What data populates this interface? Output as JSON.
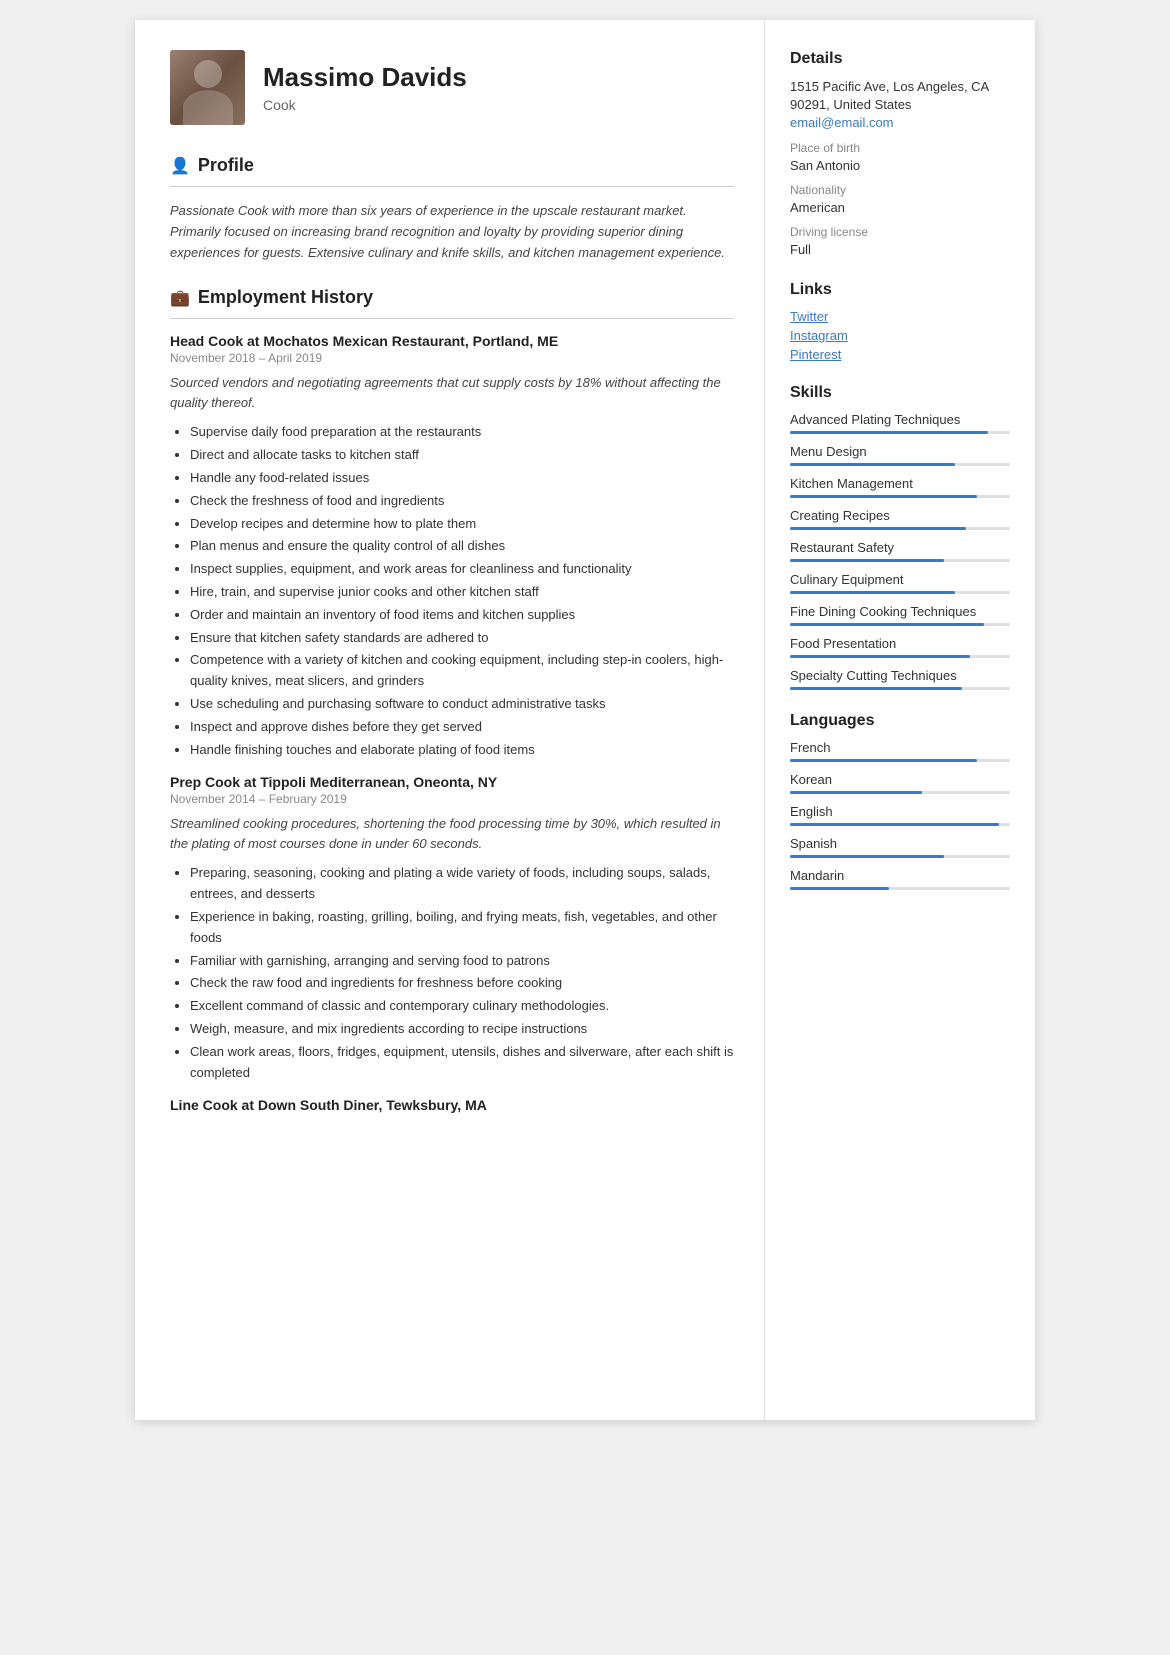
{
  "header": {
    "name": "Massimo Davids",
    "subtitle": "Cook",
    "avatar_alt": "Chef photo"
  },
  "profile": {
    "section_title": "Profile",
    "text": "Passionate Cook with more than six years of experience in the upscale restaurant market. Primarily focused on increasing brand recognition and loyalty by providing superior dining experiences for guests. Extensive culinary and knife skills, and kitchen management experience."
  },
  "employment": {
    "section_title": "Employment History",
    "jobs": [
      {
        "title": "Head Cook at Mochatos Mexican Restaurant, Portland, ME",
        "dates": "November 2018  –  April 2019",
        "summary": "Sourced vendors and negotiating agreements that cut supply costs by 18% without affecting the quality thereof.",
        "bullets": [
          "Supervise daily food preparation at the restaurants",
          "Direct and allocate tasks to kitchen staff",
          "Handle any food-related issues",
          "Check the freshness of food and ingredients",
          "Develop recipes and determine how to plate them",
          "Plan menus and ensure the quality control of all dishes",
          "Inspect supplies, equipment, and work areas for cleanliness and functionality",
          "Hire, train, and supervise junior cooks and other kitchen staff",
          "Order and maintain an inventory of food items and kitchen supplies",
          "Ensure that kitchen safety standards are adhered to",
          "Competence with a variety of kitchen and cooking equipment, including step-in coolers, high-quality knives, meat slicers, and grinders",
          "Use scheduling and purchasing software to conduct administrative tasks",
          "Inspect and approve dishes before they get served",
          "Handle finishing touches and elaborate plating of food items"
        ]
      },
      {
        "title": "Prep Cook at Tippoli Mediterranean, Oneonta, NY",
        "dates": "November 2014  –  February 2019",
        "summary": "Streamlined cooking procedures, shortening the food processing time by 30%, which resulted in the plating of most courses done in under 60 seconds.",
        "bullets": [
          "Preparing, seasoning, cooking and plating a wide variety of foods, including soups, salads, entrees, and desserts",
          "Experience in baking, roasting, grilling, boiling, and frying meats, fish, vegetables, and other foods",
          "Familiar with garnishing, arranging and serving food to patrons",
          "Check the raw food and ingredients for freshness before cooking",
          "Excellent command of classic and contemporary culinary methodologies.",
          "Weigh, measure, and mix ingredients according to recipe instructions",
          "Clean work areas, floors, fridges, equipment, utensils, dishes and silverware, after each shift is completed"
        ]
      },
      {
        "title": "Line Cook at Down South Diner, Tewksbury, MA",
        "dates": "",
        "summary": "",
        "bullets": []
      }
    ]
  },
  "details": {
    "section_title": "Details",
    "address": "1515 Pacific Ave, Los Angeles, CA 90291, United States",
    "email": "email@email.com",
    "place_of_birth_label": "Place of birth",
    "place_of_birth": "San Antonio",
    "nationality_label": "Nationality",
    "nationality": "American",
    "driving_license_label": "Driving license",
    "driving_license": "Full"
  },
  "links": {
    "section_title": "Links",
    "items": [
      {
        "label": "Twitter",
        "url": "#"
      },
      {
        "label": "Instagram",
        "url": "#"
      },
      {
        "label": "Pinterest",
        "url": "#"
      }
    ]
  },
  "skills": {
    "section_title": "Skills",
    "items": [
      {
        "name": "Advanced Plating Techniques",
        "level": 90
      },
      {
        "name": "Menu Design",
        "level": 75
      },
      {
        "name": "Kitchen Management",
        "level": 85
      },
      {
        "name": "Creating Recipes",
        "level": 80
      },
      {
        "name": "Restaurant Safety",
        "level": 70
      },
      {
        "name": "Culinary Equipment",
        "level": 75
      },
      {
        "name": "Fine Dining Cooking Techniques",
        "level": 88
      },
      {
        "name": "Food Presentation",
        "level": 82
      },
      {
        "name": "Specialty Cutting Techniques",
        "level": 78
      }
    ]
  },
  "languages": {
    "section_title": "Languages",
    "items": [
      {
        "name": "French",
        "level": 85
      },
      {
        "name": "Korean",
        "level": 60
      },
      {
        "name": "English",
        "level": 95
      },
      {
        "name": "Spanish",
        "level": 70
      },
      {
        "name": "Mandarin",
        "level": 45
      }
    ]
  }
}
